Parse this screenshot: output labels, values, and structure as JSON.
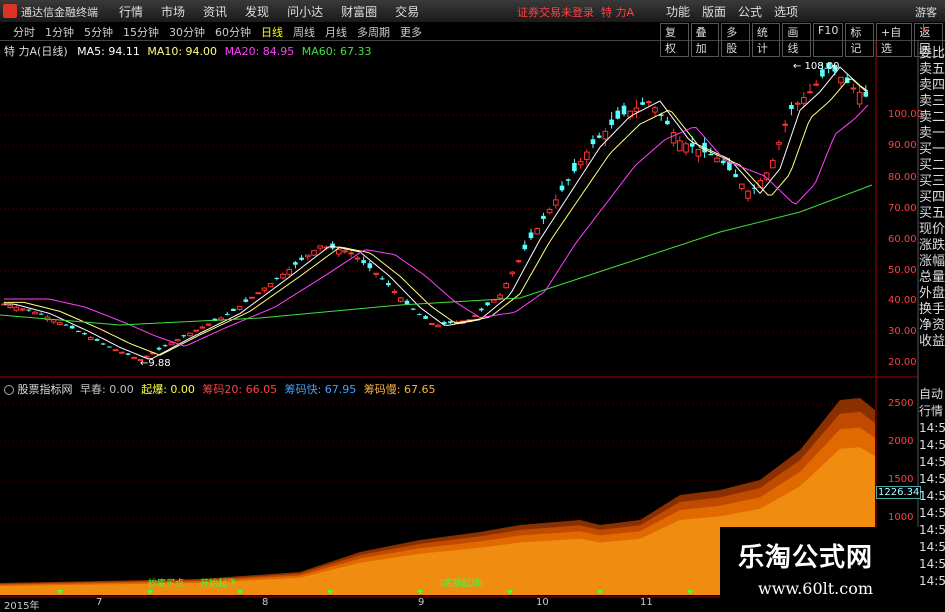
{
  "menubar": {
    "app_title": "通达信金融终端",
    "menus": [
      "行情",
      "市场",
      "资讯",
      "发现",
      "问小达",
      "财富圈",
      "交易"
    ],
    "status": "证券交易未登录",
    "stock": "特 力A",
    "right_menus": [
      "功能",
      "版面",
      "公式",
      "选项"
    ],
    "user": "游客"
  },
  "tabs": {
    "items": [
      "分时",
      "1分钟",
      "5分钟",
      "15分钟",
      "30分钟",
      "60分钟",
      "日线",
      "周线",
      "月线",
      "多周期",
      "更多"
    ],
    "active": "日线",
    "tools": [
      "复权",
      "叠加",
      "多股",
      "统计",
      "画线",
      "F10",
      "标记",
      "+自选",
      "返回"
    ]
  },
  "main_info": {
    "name": "特 力A",
    "period": "(日线)",
    "ma5": "MA5: 94.11",
    "ma10": "MA10: 94.00",
    "ma20": "MA20: 84.95",
    "ma60": "MA60: 67.33",
    "ma5_color": "#ffffff",
    "ma10_color": "#ffff80",
    "ma20_color": "#ff40ff",
    "ma60_color": "#40e040"
  },
  "price_axis": {
    "labels": [
      "100.00",
      "90.00",
      "80.00",
      "70.00",
      "60.00",
      "50.00",
      "40.00",
      "30.00",
      "20.00"
    ],
    "top_label": "L",
    "mid_label": "R",
    "bottom_label": "N"
  },
  "annotations": {
    "high": "108.00",
    "low": "9.88"
  },
  "side_panel": [
    "委比",
    "卖五",
    "卖四",
    "卖三",
    "卖二",
    "卖一",
    "买一",
    "买二",
    "买三",
    "买四",
    "买五",
    "现价",
    "涨跌",
    "涨幅",
    "总量",
    "外盘",
    "换手",
    "净资",
    "收益"
  ],
  "side_panel2": [
    "自动",
    "行情",
    "14:5",
    "14:5",
    "14:5",
    "14:5",
    "14:5",
    "14:5",
    "14:5",
    "14:5",
    "14:5",
    "14:5"
  ],
  "indicator": {
    "name": "股票指标网",
    "items": [
      {
        "label": "早春: 0.00",
        "color": "#c0c0c0"
      },
      {
        "label": "起爆: 0.00",
        "color": "#ffff40"
      },
      {
        "label": "筹码20: 66.05",
        "color": "#ff4040"
      },
      {
        "label": "筹码快: 67.95",
        "color": "#40a0ff"
      },
      {
        "label": "筹码慢: 67.65",
        "color": "#ffb040"
      }
    ],
    "axis": [
      "2500",
      "2000",
      "1500",
      "1000"
    ],
    "last_value": "1226.34",
    "tag1": "抄底买点",
    "tag2": "开始起飞",
    "tag3": "(底部起动)"
  },
  "xaxis": [
    "2015年",
    "7",
    "8",
    "9",
    "10",
    "11"
  ],
  "watermark": {
    "title": "乐淘公式网",
    "url": "www.60lt.com"
  }
}
